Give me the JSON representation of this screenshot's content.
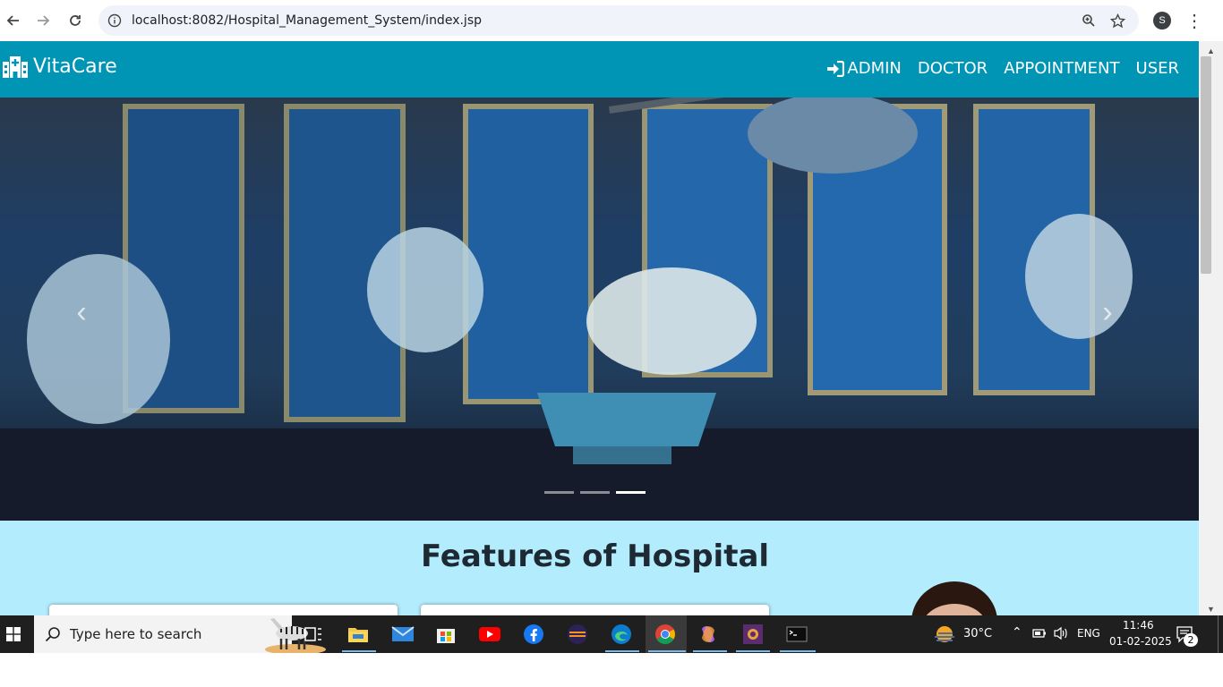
{
  "browser": {
    "url": "localhost:8082/Hospital_Management_System/index.jsp",
    "profile_initial": "S"
  },
  "navbar": {
    "brand": "VitaCare",
    "links": [
      "ADMIN",
      "DOCTOR",
      "APPOINTMENT",
      "USER"
    ]
  },
  "carousel": {
    "slide_count": 3,
    "active_index": 2
  },
  "features": {
    "title": "Features of Hospital"
  },
  "taskbar": {
    "search_placeholder": "Type here to search",
    "weather": "30°C",
    "language": "ENG",
    "time": "11:46",
    "date": "01-02-2025",
    "notification_count": "2"
  },
  "colors": {
    "navbar": "#0094b5",
    "features_bg": "#b3ecfd"
  }
}
